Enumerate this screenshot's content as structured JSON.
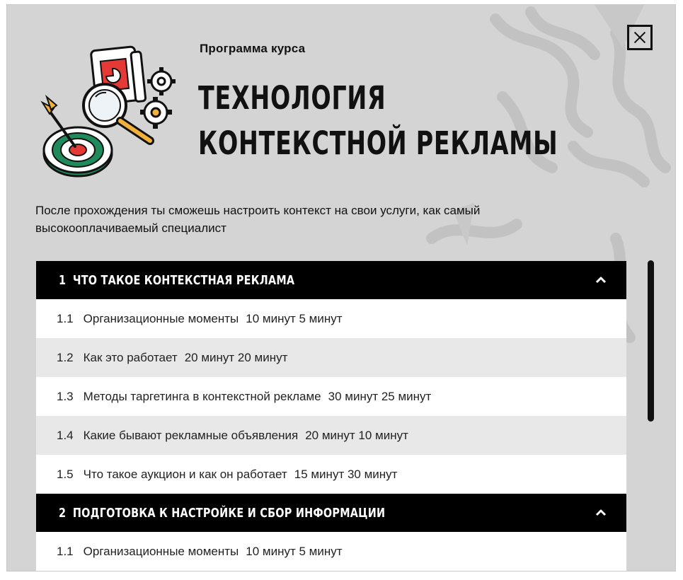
{
  "header": {
    "subtitle": "Программа курса",
    "title_line1": "ТЕХНОЛОГИЯ",
    "title_line2": "КОНТЕКСТНОЙ РЕКЛАМЫ",
    "description": "После прохождения ты сможешь настроить контекст на свои услуги, как самый высокооплачиваемый специалист"
  },
  "icons": {
    "close": "close-icon",
    "chevron": "chevron-up-icon",
    "illustration": "target-magnifier-gears-illustration"
  },
  "colors": {
    "modal_bg": "#d4d4d4",
    "header_bg": "#000000",
    "row_alt": "#e8e8e8",
    "accent_red": "#e53935",
    "accent_green": "#1f8a5b"
  },
  "sections": [
    {
      "number": "1",
      "title": "ЧТО ТАКОЕ КОНТЕКСТНАЯ РЕКЛАМА",
      "lessons": [
        {
          "number": "1.1",
          "title": "Организационные моменты",
          "duration": "10 минут 5 минут"
        },
        {
          "number": "1.2",
          "title": "Как это работает",
          "duration": "20 минут 20 минут"
        },
        {
          "number": "1.3",
          "title": "Методы таргетинга в контекстной рекламе",
          "duration": "30 минут 25 минут"
        },
        {
          "number": "1.4",
          "title": "Какие бывают рекламные объявления",
          "duration": "20 минут 10 минут"
        },
        {
          "number": "1.5",
          "title": "Что такое аукцион и как он работает",
          "duration": "15 минут 30 минут"
        }
      ]
    },
    {
      "number": "2",
      "title": "ПОДГОТОВКА К НАСТРОЙКЕ И СБОР ИНФОРМАЦИИ",
      "lessons": [
        {
          "number": "1.1",
          "title": "Организационные моменты",
          "duration": "10 минут 5 минут"
        }
      ]
    }
  ]
}
